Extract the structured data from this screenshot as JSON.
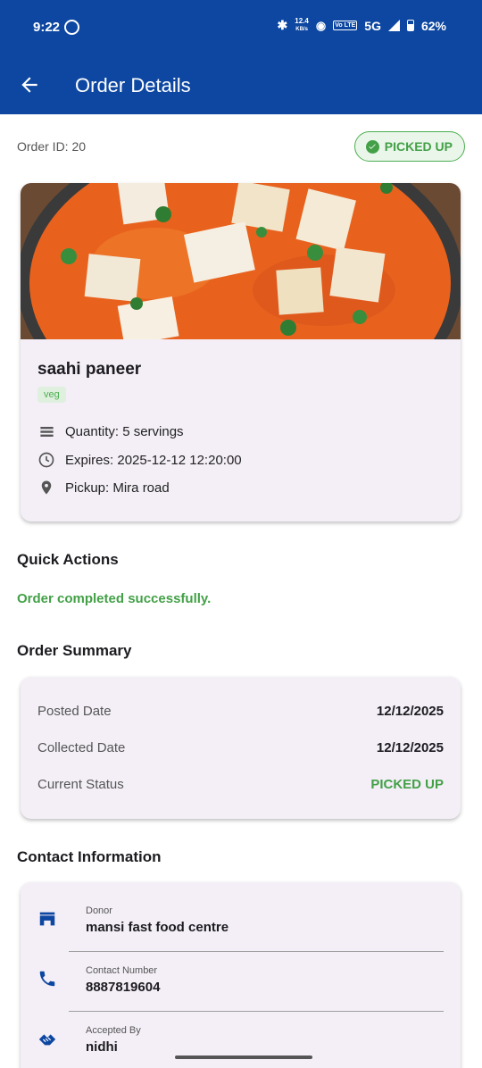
{
  "status_bar": {
    "time": "9:22",
    "net_speed_top": "12.4",
    "net_speed_unit": "KB/s",
    "volte": "Vo LTE",
    "network": "5G",
    "battery": "62%"
  },
  "app_bar": {
    "title": "Order Details",
    "back_icon": "arrow-back-icon"
  },
  "order": {
    "id_label": "Order ID: 20",
    "status": "PICKED UP"
  },
  "food": {
    "name": "saahi paneer",
    "tag": "veg",
    "quantity": "Quantity: 5 servings",
    "expires": "Expires: 2025-12-12 12:20:00",
    "pickup": "Pickup: Mira road"
  },
  "quick_actions": {
    "title": "Quick Actions",
    "message": "Order completed successfully."
  },
  "summary": {
    "title": "Order Summary",
    "rows": [
      {
        "label": "Posted Date",
        "value": "12/12/2025"
      },
      {
        "label": "Collected Date",
        "value": "12/12/2025"
      },
      {
        "label": "Current Status",
        "value": "PICKED UP"
      }
    ]
  },
  "contact": {
    "title": "Contact Information",
    "rows": [
      {
        "label": "Donor",
        "value": "mansi fast food centre",
        "icon": "store-icon"
      },
      {
        "label": "Contact Number",
        "value": "8887819604",
        "icon": "phone-icon"
      },
      {
        "label": "Accepted By",
        "value": "nidhi",
        "icon": "volunteer-icon"
      }
    ]
  },
  "colors": {
    "primary": "#0d47a1",
    "success": "#43a047",
    "card_bg": "#f4eff7"
  }
}
